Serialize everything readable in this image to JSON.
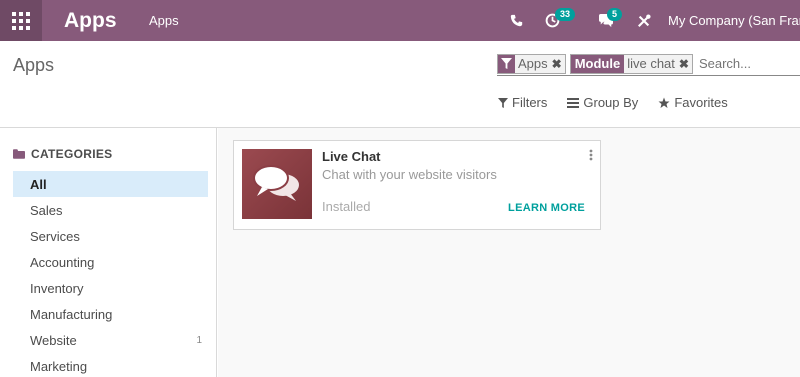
{
  "navbar": {
    "brand": "Apps",
    "menu": [
      "Apps"
    ],
    "activity_badge": "33",
    "messages_badge": "5",
    "company": "My Company (San Francisco)"
  },
  "control_panel": {
    "breadcrumb": "Apps",
    "facets": [
      {
        "label": "Apps",
        "value": "",
        "icon": "filter-icon"
      },
      {
        "label": "Module",
        "value": "live chat"
      }
    ],
    "search_placeholder": "Search...",
    "filters_label": "Filters",
    "groupby_label": "Group By",
    "favorites_label": "Favorites"
  },
  "sidebar": {
    "header": "CATEGORIES",
    "items": [
      {
        "label": "All",
        "count": "",
        "active": true
      },
      {
        "label": "Sales",
        "count": ""
      },
      {
        "label": "Services",
        "count": ""
      },
      {
        "label": "Accounting",
        "count": ""
      },
      {
        "label": "Inventory",
        "count": ""
      },
      {
        "label": "Manufacturing",
        "count": ""
      },
      {
        "label": "Website",
        "count": "1"
      },
      {
        "label": "Marketing",
        "count": ""
      }
    ]
  },
  "cards": [
    {
      "title": "Live Chat",
      "summary": "Chat with your website visitors",
      "status": "Installed",
      "action": "LEARN MORE",
      "icon": "chat-bubbles-icon"
    }
  ],
  "colors": {
    "navbar": "#875a7b",
    "accent": "#00a09d",
    "active_category": "#d9ecfa",
    "app_icon": "#8b3e45"
  }
}
